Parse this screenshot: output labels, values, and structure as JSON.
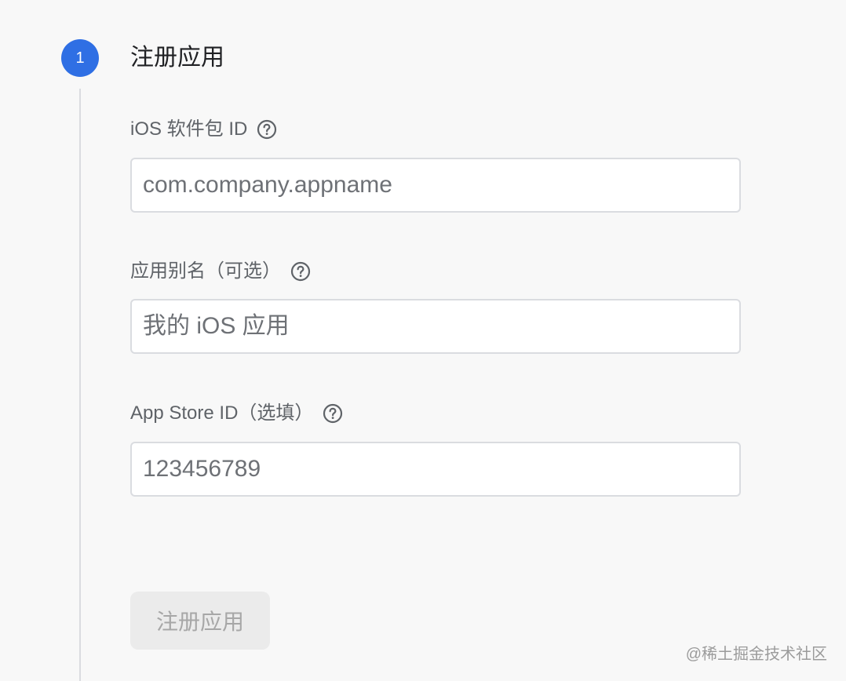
{
  "step": {
    "number": "1",
    "title": "注册应用"
  },
  "form": {
    "bundle_id": {
      "label": "iOS 软件包 ID",
      "placeholder": "com.company.appname",
      "help_icon": "help-circle-icon"
    },
    "app_nickname": {
      "label": "应用别名（可选）",
      "placeholder": "我的 iOS 应用",
      "help_icon": "help-circle-icon"
    },
    "app_store_id": {
      "label": "App Store ID（选填）",
      "placeholder": "123456789",
      "help_icon": "help-circle-icon"
    },
    "submit_label": "注册应用"
  },
  "watermark": "@稀土掘金技术社区",
  "colors": {
    "accent": "#2f6fe4",
    "background": "#f8f8f8",
    "border": "#dadce0",
    "disabled_button_bg": "#ebebeb",
    "disabled_button_text": "#a7a7a7",
    "label_text": "#5f6368"
  }
}
